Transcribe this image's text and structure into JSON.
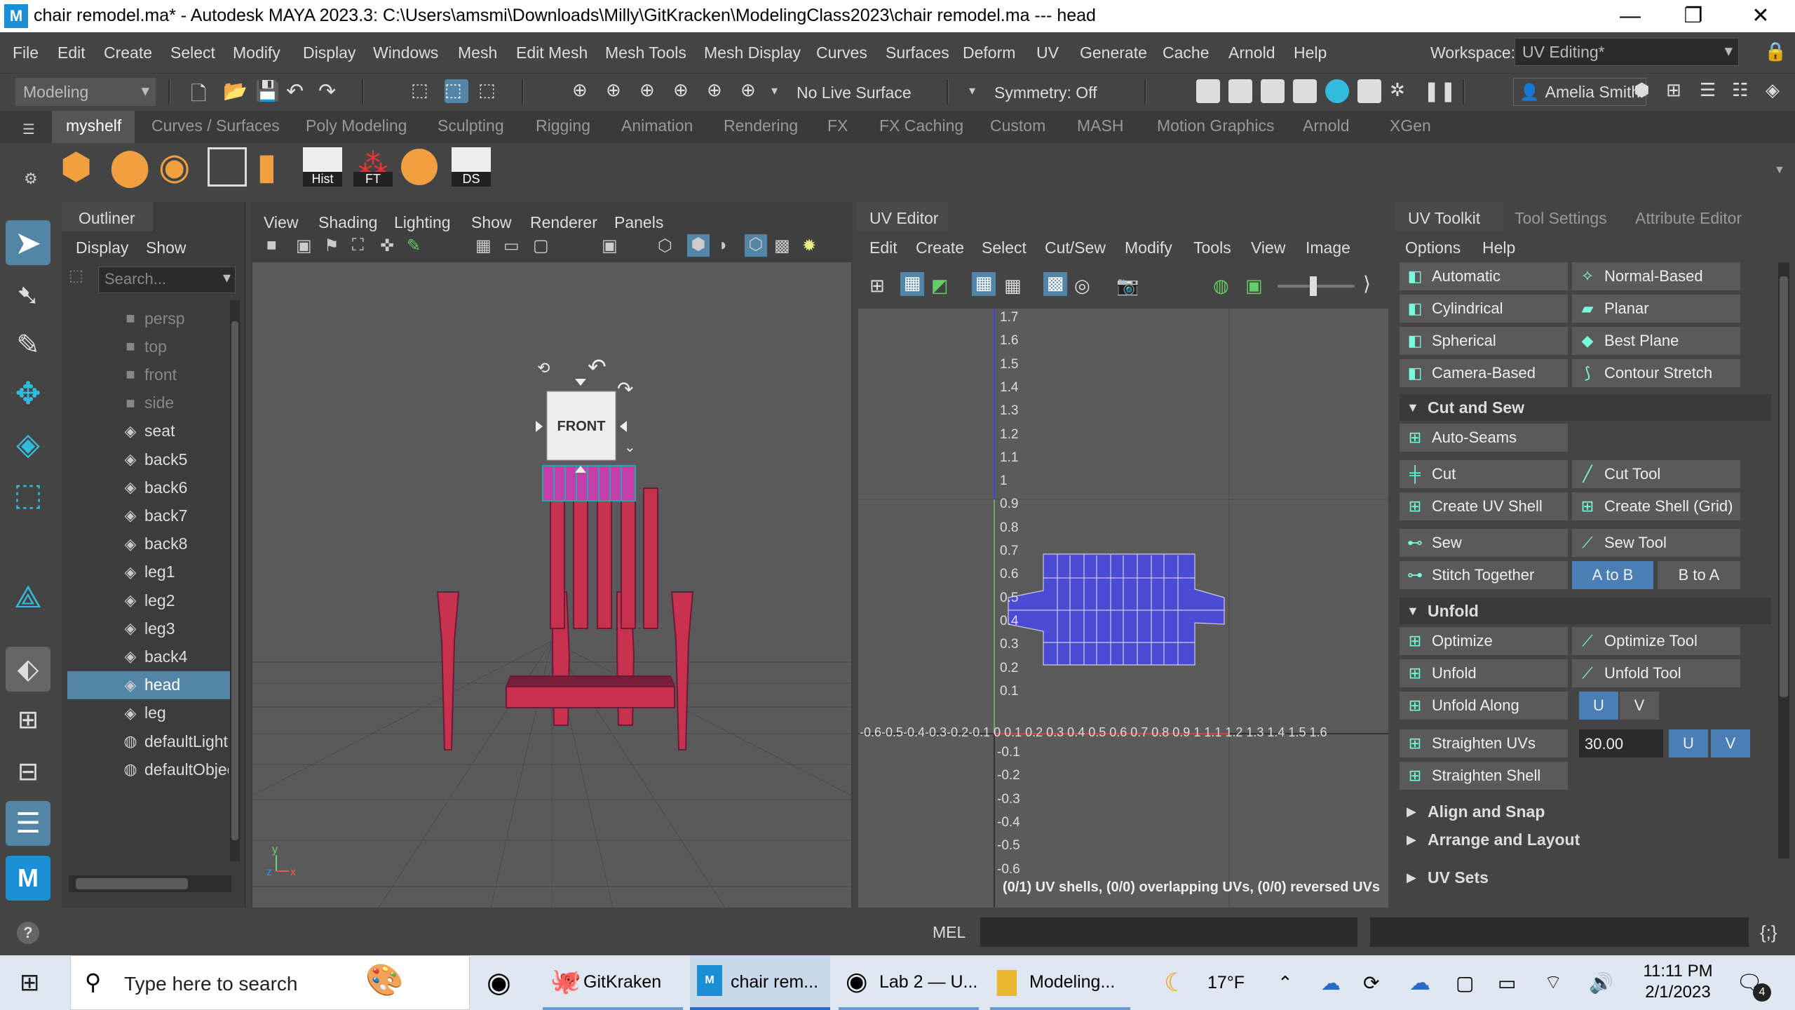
{
  "titlebar": {
    "title": "chair remodel.ma* - Autodesk MAYA 2023.3: C:\\Users\\amsmi\\Downloads\\Milly\\GitKracken\\ModelingClass2023\\chair remodel.ma   ---   head"
  },
  "menubar": {
    "items": [
      "File",
      "Edit",
      "Create",
      "Select",
      "Modify",
      "Display",
      "Windows",
      "Mesh",
      "Edit Mesh",
      "Mesh Tools",
      "Mesh Display",
      "Curves",
      "Surfaces",
      "Deform",
      "UV",
      "Generate",
      "Cache",
      "Arnold",
      "Help"
    ],
    "workspace_label": "Workspace:",
    "workspace_value": "UV Editing*"
  },
  "statusline": {
    "mode": "Modeling",
    "live_surface": "No Live Surface",
    "symmetry": "Symmetry: Off",
    "user": "Amelia Smith"
  },
  "shelf": {
    "tabs": [
      "myshelf",
      "Curves / Surfaces",
      "Poly Modeling",
      "Sculpting",
      "Rigging",
      "Animation",
      "Rendering",
      "FX",
      "FX Caching",
      "Custom",
      "MASH",
      "Motion Graphics",
      "Arnold",
      "XGen"
    ],
    "labels": {
      "hist": "Hist",
      "ft": "FT",
      "ds": "DS"
    }
  },
  "outliner": {
    "title": "Outliner",
    "menu": [
      "Display",
      "Show"
    ],
    "search_placeholder": "Search...",
    "items": [
      "persp",
      "top",
      "front",
      "side",
      "seat",
      "back5",
      "back6",
      "back7",
      "back8",
      "leg1",
      "leg2",
      "leg3",
      "back4",
      "head",
      "leg",
      "defaultLightS",
      "defaultObjec"
    ],
    "selected": "head"
  },
  "viewport": {
    "menu": [
      "View",
      "Shading",
      "Lighting",
      "Show",
      "Renderer",
      "Panels"
    ],
    "viewcube": "FRONT"
  },
  "uveditor": {
    "title": "UV Editor",
    "menu": [
      "Edit",
      "Create",
      "Select",
      "Cut/Sew",
      "Modify",
      "Tools",
      "View",
      "Image"
    ],
    "v_ticks_pos": [
      "1.7",
      "1.6",
      "1.5",
      "1.4",
      "1.3",
      "1.2",
      "1.1",
      "1",
      "0.9",
      "0.8",
      "0.7",
      "0.6",
      "0.5",
      "0.4",
      "0.3",
      "0.2",
      "0.1"
    ],
    "v_ticks_neg": [
      "-0.1",
      "-0.2",
      "-0.3",
      "-0.4",
      "-0.5",
      "-0.6"
    ],
    "u_axis_label": "-0.6-0.5-0.4-0.3-0.2-0.1 0  0.1 0.2 0.3 0.4 0.5 0.6 0.7 0.8 0.9 1  1.1 1.2 1.3 1.4 1.5 1.6",
    "status": "(0/1) UV shells, (0/0) overlapping UVs, (0/0) reversed UVs"
  },
  "toolkit": {
    "tabs": [
      "UV Toolkit",
      "Tool Settings",
      "Attribute Editor"
    ],
    "menu": [
      "Options",
      "Help"
    ],
    "projection": [
      "Automatic",
      "Normal-Based",
      "Cylindrical",
      "Planar",
      "Spherical",
      "Best Plane",
      "Camera-Based",
      "Contour Stretch"
    ],
    "cut_and_sew": {
      "title": "Cut and Sew",
      "auto_seams": "Auto-Seams",
      "cut": "Cut",
      "cut_tool": "Cut Tool",
      "create_uv_shell": "Create UV Shell",
      "create_shell_grid": "Create Shell (Grid)",
      "sew": "Sew",
      "sew_tool": "Sew Tool",
      "stitch_together": "Stitch Together",
      "a_to_b": "A to B",
      "b_to_a": "B to A"
    },
    "unfold": {
      "title": "Unfold",
      "optimize": "Optimize",
      "optimize_tool": "Optimize Tool",
      "unfold": "Unfold",
      "unfold_tool": "Unfold Tool",
      "unfold_along": "Unfold Along",
      "u": "U",
      "v": "V",
      "straighten_uvs": "Straighten UVs",
      "straighten_value": "30.00",
      "straighten_shell": "Straighten Shell"
    },
    "sections_collapsed": [
      "Align and Snap",
      "Arrange and Layout",
      "UV Sets"
    ]
  },
  "helpline": {
    "mel": "MEL"
  },
  "taskbar": {
    "search_placeholder": "Type here to search",
    "apps": [
      "GitKraken",
      "chair rem...",
      "Lab 2 — U...",
      "Modeling..."
    ],
    "weather": "17°F",
    "time": "11:11 PM",
    "date": "2/1/2023",
    "notification_count": "4"
  },
  "colors": {
    "selected": "#5285a6",
    "toolkit_blue": "#4a7fb5",
    "uv_shell": "#4b4bd6",
    "chair_red": "#c8324f",
    "chair_head": "#c43fa9"
  }
}
